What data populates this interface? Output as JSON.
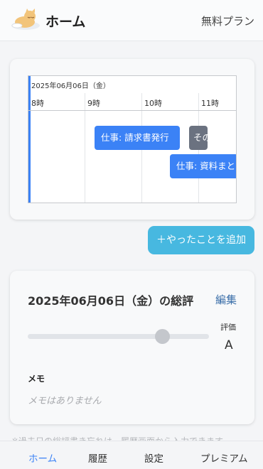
{
  "header": {
    "title": "ホーム",
    "plan": "無料プラン",
    "logo": "sleeping-cat-logo"
  },
  "timeline": {
    "date": "2025年06月06日（金）",
    "hours": [
      "8時",
      "9時",
      "10時",
      "11時"
    ],
    "events": [
      {
        "label": "仕事: 請求書発行",
        "color": "#3b82f6"
      },
      {
        "label": "その",
        "color": "#6b7280"
      },
      {
        "label": "仕事: 資料まとめ",
        "color": "#3b82f6"
      }
    ]
  },
  "add_button": "＋やったことを追加",
  "summary": {
    "title": "2025年06月06日（金）の総評",
    "edit": "編集",
    "rating_label": "評価",
    "rating_value": "A",
    "rating_level": 0.74,
    "memo_label": "メモ",
    "memo_text": "メモはありません"
  },
  "note": "※過去日の総評書き忘れは、履歴画面から入力できます。",
  "nav": {
    "items": [
      "ホーム",
      "履歴",
      "設定",
      "プレミアム"
    ],
    "active": "ホーム"
  },
  "colors": {
    "accent": "#3b82f6",
    "add_button": "#47b8e0",
    "link": "#3a6ea8"
  }
}
